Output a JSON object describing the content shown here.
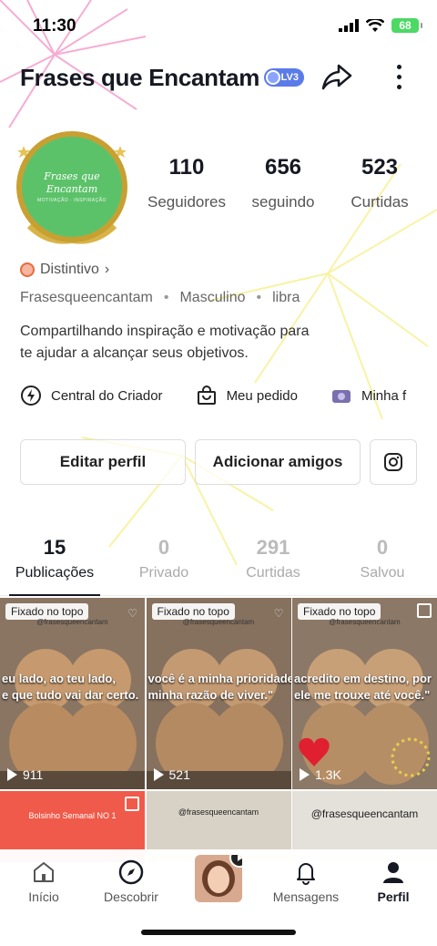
{
  "status_bar": {
    "time": "11:30",
    "battery": "68"
  },
  "header": {
    "profile_name": "Frases que Encantam",
    "level": "LV3",
    "share_icon": "share-arrow-icon",
    "more_icon": "more-vertical-icon"
  },
  "avatar": {
    "title_line1": "Frases que Encantam",
    "subtitle": "MOTIVAÇÃO · INSPIRAÇÃO"
  },
  "stats": [
    {
      "value": "110",
      "label": "Seguidores"
    },
    {
      "value": "656",
      "label": "seguindo"
    },
    {
      "value": "523",
      "label": "Curtidas"
    }
  ],
  "badge": {
    "label": "Distintivo",
    "chevron": "›"
  },
  "meta": {
    "username": "Frasesqueencantam",
    "gender": "Masculino",
    "sign": "libra",
    "separator": "•"
  },
  "bio": {
    "line1": "Compartilhando inspiração e motivação para",
    "line2": "te ajudar a alcançar seus objetivos."
  },
  "quick_links": [
    {
      "icon": "lightning-icon",
      "label": "Central do Criador"
    },
    {
      "icon": "shopping-bag-icon",
      "label": "Meu pedido"
    },
    {
      "icon": "image-thumb-icon",
      "label": "Minha f"
    }
  ],
  "actions": {
    "edit_profile": "Editar perfil",
    "add_friends": "Adicionar amigos",
    "instagram_icon": "instagram-icon"
  },
  "tabs": [
    {
      "value": "15",
      "label": "Publicações",
      "active": true
    },
    {
      "value": "0",
      "label": "Privado",
      "active": false
    },
    {
      "value": "291",
      "label": "Curtidas",
      "active": false
    },
    {
      "value": "0",
      "label": "Salvou",
      "active": false
    }
  ],
  "posts": [
    {
      "pinned": "Fixado no topo",
      "handle": "@frasesqueencantam",
      "caption1": "eu lado, ao teu lado, ",
      "caption2": "e que tudo vai dar certo.",
      "views": "911"
    },
    {
      "pinned": "Fixado no topo",
      "handle": "@frasesqueencantam",
      "caption1": "você é a minha prioridade",
      "caption2": "minha razão de viver.\"",
      "views": "521"
    },
    {
      "pinned": "Fixado no topo",
      "handle": "@frasesqueencantam",
      "caption1": "acredito em destino, por",
      "caption2": "ele me trouxe até você.\"",
      "views": "1.3K"
    },
    {
      "text": "Bolsinho Semanal NO 1"
    },
    {
      "handle": "@frasesqueencantam"
    },
    {
      "handle": "@frasesqueencantam"
    }
  ],
  "nav": [
    {
      "icon": "home-icon",
      "label": "Início",
      "active": false
    },
    {
      "icon": "compass-icon",
      "label": "Descobrir",
      "active": false
    },
    {
      "icon": "create-icon",
      "label": "",
      "active": false
    },
    {
      "icon": "bell-icon",
      "label": "Mensagens",
      "active": false
    },
    {
      "icon": "person-icon",
      "label": "Perfil",
      "active": true
    }
  ],
  "colors": {
    "text_primary": "#161823",
    "avatar_green": "#5cc26a",
    "avatar_gold": "#c8a032",
    "level_blue": "#5b7be8",
    "battery_green": "#4cd964"
  }
}
